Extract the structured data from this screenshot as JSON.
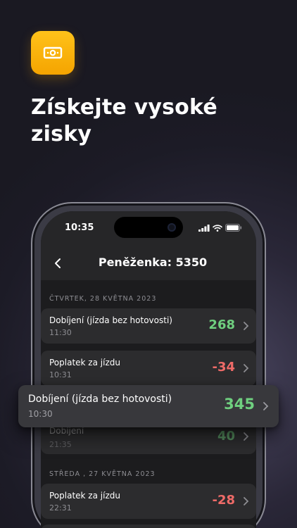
{
  "promo": {
    "app_icon": "banknote-icon",
    "headline": "Získejte vysoké zisky"
  },
  "phone": {
    "status": {
      "time": "10:35",
      "icons": [
        "signal-icon",
        "wifi-icon",
        "battery-icon"
      ]
    },
    "nav": {
      "title": "Peněženka: 5350",
      "back_icon": "chevron-left-icon"
    },
    "sections": [
      {
        "header": "ČTVRTEK, 28 KVĚTNA 2023",
        "items": [
          {
            "title": "Dobíjení (jízda bez hotovosti)",
            "time": "11:30",
            "amount": "268",
            "sign": "positive"
          },
          {
            "title": "Poplatek za jízdu",
            "time": "10:31",
            "amount": "-34",
            "sign": "negative"
          },
          {
            "title": "Dobíjení",
            "time": "21:35",
            "amount": "40",
            "sign": "positive"
          }
        ]
      },
      {
        "header": "STŘEDA , 27 KVĚTNA 2023",
        "items": [
          {
            "title": "Poplatek za jízdu",
            "time": "22:31",
            "amount": "-28",
            "sign": "negative"
          }
        ]
      }
    ],
    "highlighted": {
      "title": "Dobíjení (jízda bez hotovosti)",
      "time": "10:30",
      "amount": "345"
    }
  },
  "colors": {
    "accent": "#f5a400",
    "positive": "#6fcf7f",
    "negative": "#ef6b68",
    "card": "#2c2c2e",
    "background": "#1c1b26"
  }
}
